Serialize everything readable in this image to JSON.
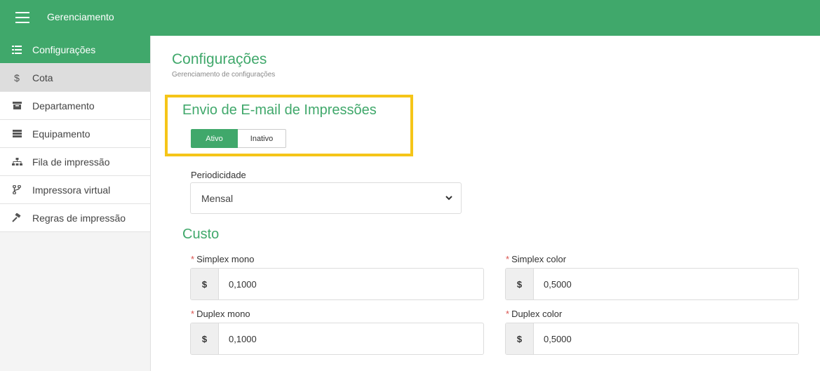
{
  "header": {
    "title": "Gerenciamento"
  },
  "sidebar": {
    "items": [
      {
        "label": "Configurações",
        "icon": "list-icon"
      },
      {
        "label": "Cota",
        "icon": "dollar-icon"
      },
      {
        "label": "Departamento",
        "icon": "archive-icon"
      },
      {
        "label": "Equipamento",
        "icon": "server-icon"
      },
      {
        "label": "Fila de impressão",
        "icon": "sitemap-icon"
      },
      {
        "label": "Impressora virtual",
        "icon": "branch-icon"
      },
      {
        "label": "Regras de impressão",
        "icon": "gavel-icon"
      }
    ]
  },
  "main": {
    "title": "Configurações",
    "subtitle": "Gerenciamento de configurações",
    "email_section": {
      "title": "Envio de E-mail de Impressões",
      "active_label": "Ativo",
      "inactive_label": "Inativo",
      "selected": "Ativo"
    },
    "periodicidade": {
      "label": "Periodicidade",
      "value": "Mensal"
    },
    "custo": {
      "title": "Custo",
      "currency": "$",
      "simplex_mono": {
        "label": "Simplex mono",
        "value": "0,1000"
      },
      "simplex_color": {
        "label": "Simplex color",
        "value": "0,5000"
      },
      "duplex_mono": {
        "label": "Duplex mono",
        "value": "0,1000"
      },
      "duplex_color": {
        "label": "Duplex color",
        "value": "0,5000"
      }
    }
  },
  "colors": {
    "brand": "#40a86b",
    "highlight": "#f5c518",
    "required": "#d9534f"
  }
}
